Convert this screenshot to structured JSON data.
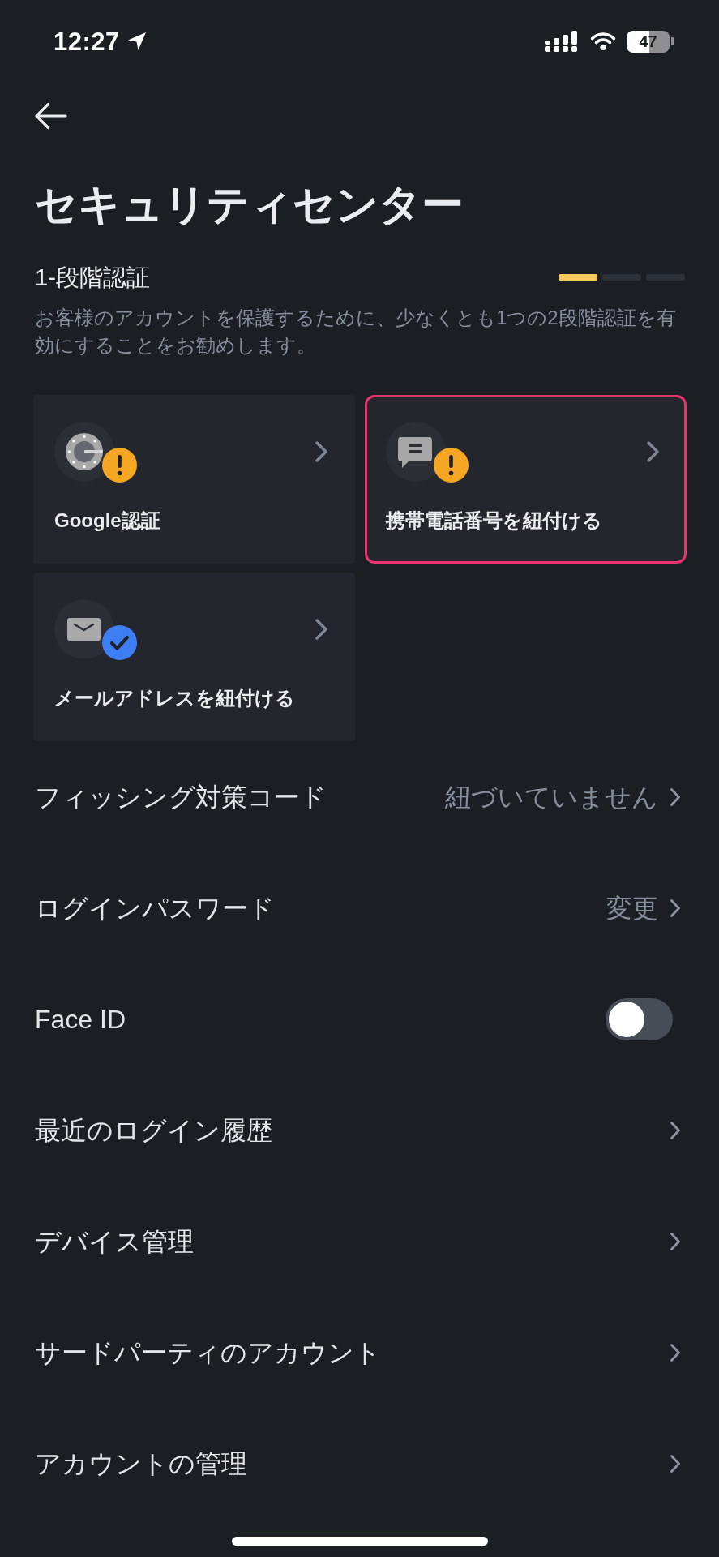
{
  "status_bar": {
    "time": "12:27",
    "battery": "47"
  },
  "header": {
    "title": "セキュリティセンター"
  },
  "two_factor": {
    "heading": "1-段階認証",
    "progress": [
      {
        "filled": true
      },
      {
        "filled": false
      },
      {
        "filled": false
      }
    ],
    "description": "お客様のアカウントを保護するために、少なくとも1つの2段階認証を有効にすることをお勧めします。",
    "methods": [
      {
        "kind": "authenticator",
        "label": "Google認証",
        "verified": false,
        "highlighted": false
      },
      {
        "kind": "phone",
        "label": "携帯電話番号を紐付ける",
        "verified": false,
        "highlighted": true
      },
      {
        "kind": "email",
        "label": "メールアドレスを紐付ける",
        "verified": true,
        "highlighted": false
      }
    ]
  },
  "settings": [
    {
      "kind": "link",
      "label": "フィッシング対策コード",
      "value": "紐づいていません"
    },
    {
      "kind": "link",
      "label": "ログインパスワード",
      "value": "変更"
    },
    {
      "kind": "toggle",
      "label": "Face ID",
      "on": false
    },
    {
      "kind": "link",
      "label": "最近のログイン履歴"
    },
    {
      "kind": "link",
      "label": "デバイス管理"
    },
    {
      "kind": "link",
      "label": "サードパーティのアカウント"
    },
    {
      "kind": "link",
      "label": "アカウントの管理"
    }
  ]
}
